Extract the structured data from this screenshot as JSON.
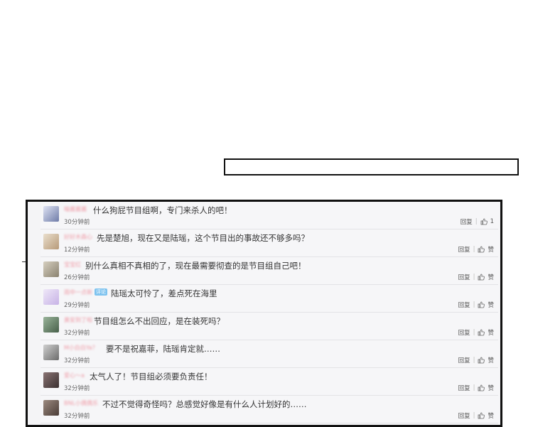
{
  "comments": [
    {
      "user": "喵酱酱酱",
      "tag": "",
      "text": "什么狗屁节目组啊，专门来杀人的吧！",
      "time": "30分钟前",
      "reply": "回复",
      "likes": "1",
      "avatar_color": "#6f7ca8"
    },
    {
      "user": "好好木森心",
      "tag": "",
      "text": "先是楚旭，现在又是陆瑶，这个节目出的事故还不够多吗？",
      "time": "12分钟前",
      "reply": "回复",
      "likes": "赞",
      "avatar_color": "#b79a78"
    },
    {
      "user": "宝宝红",
      "tag": "",
      "text": "别什么真相不真相的了，现在最需要彻查的是节目组自己吧！",
      "time": "26分钟前",
      "reply": "回复",
      "likes": "赞",
      "avatar_color": "#8a8270"
    },
    {
      "user": "雨中一点新",
      "tag": "评论",
      "text": "陆瑶太可怜了，差点死在海里",
      "time": "29分钟前",
      "reply": "回复",
      "likes": "赞",
      "avatar_color": "#c7b2e6"
    },
    {
      "user": "黄安到了啦",
      "tag": "",
      "text": "节目组怎么不出回应，是在装死吗？",
      "time": "32分钟前",
      "reply": "回复",
      "likes": "赞",
      "avatar_color": "#47604a"
    },
    {
      "user": "M小白白Ya？",
      "tag": "",
      "text": "要不是祝嘉菲，陆瑶肯定就……",
      "time": "32分钟前",
      "reply": "回复",
      "likes": "赞",
      "avatar_color": "#6b6b6b"
    },
    {
      "user": "爱心～a",
      "tag": "",
      "text": "太气人了！节目组必须要负责任！",
      "time": "32分钟前",
      "reply": "回复",
      "likes": "赞",
      "avatar_color": "#3b3030"
    },
    {
      "user": "BNL小偶偶乐",
      "tag": "",
      "text": "不过不觉得奇怪吗？总感觉好像是有什么人计划好的……",
      "time": "32分钟前",
      "reply": "回复",
      "likes": "赞",
      "avatar_color": "#4a3c36"
    }
  ]
}
